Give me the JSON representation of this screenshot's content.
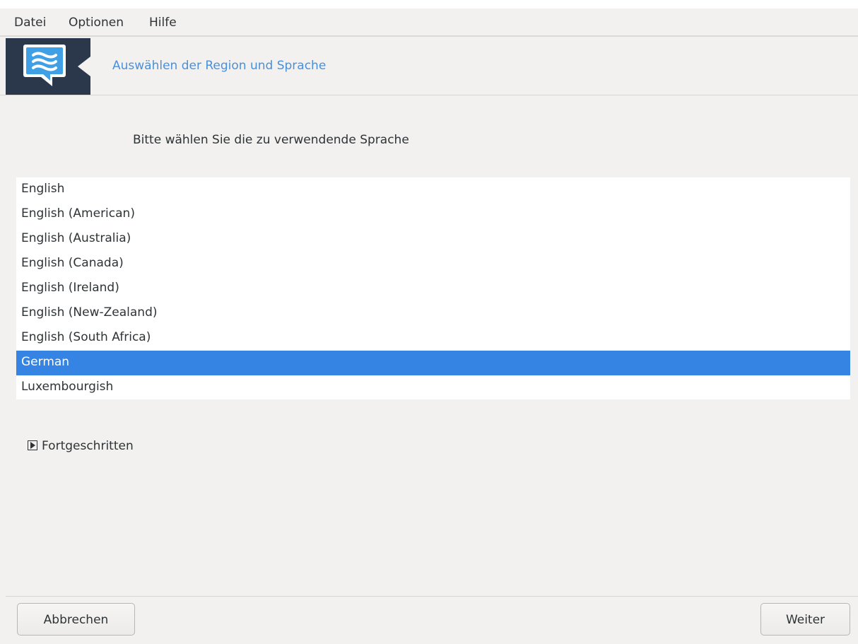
{
  "menubar": {
    "items": [
      "Datei",
      "Optionen",
      "Hilfe"
    ]
  },
  "header": {
    "icon": "chat-bubble-icon",
    "title": "Auswählen der Region und Sprache"
  },
  "prompt": "Bitte wählen Sie die zu verwendende Sprache",
  "languages": {
    "items": [
      "English",
      "English (American)",
      "English (Australia)",
      "English (Canada)",
      "English (Ireland)",
      "English (New-Zealand)",
      "English (South Africa)",
      "German",
      "Luxembourgish"
    ],
    "selected": "German"
  },
  "advanced": {
    "icon": "expander-right-icon",
    "label": "Fortgeschritten"
  },
  "buttons": {
    "cancel": "Abbrechen",
    "next": "Weiter"
  },
  "colors": {
    "accent": "#3584e4",
    "header_title": "#4a90d9",
    "icon_background": "#2b384b"
  }
}
